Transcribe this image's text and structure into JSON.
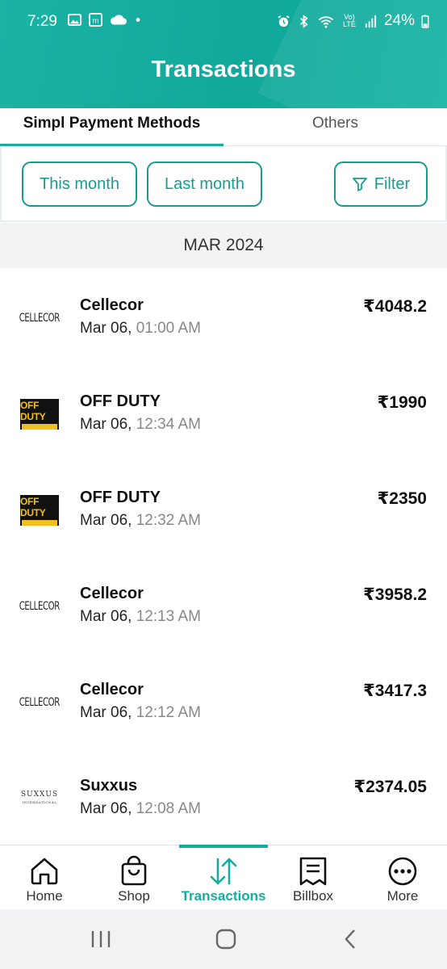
{
  "status_bar": {
    "time": "7:29",
    "battery": "24%",
    "network": "Vo) LTE"
  },
  "header": {
    "title": "Transactions"
  },
  "tabs": [
    {
      "label": "Simpl Payment Methods",
      "active": true
    },
    {
      "label": "Others",
      "active": false
    }
  ],
  "filters": {
    "this_month": "This month",
    "last_month": "Last month",
    "filter": "Filter"
  },
  "section": {
    "month": "MAR 2024"
  },
  "transactions": [
    {
      "merchant": "Cellecor",
      "logo": "cellecor-logo",
      "date": "Mar 06,",
      "time": " 01:00 AM",
      "amount": "₹4048.2"
    },
    {
      "merchant": "OFF DUTY",
      "logo": "offduty-logo",
      "date": "Mar 06,",
      "time": " 12:34 AM",
      "amount": "₹1990"
    },
    {
      "merchant": "OFF DUTY",
      "logo": "offduty-logo",
      "date": "Mar 06,",
      "time": " 12:32 AM",
      "amount": "₹2350"
    },
    {
      "merchant": "Cellecor",
      "logo": "cellecor-logo",
      "date": "Mar 06,",
      "time": " 12:13 AM",
      "amount": "₹3958.2"
    },
    {
      "merchant": "Cellecor",
      "logo": "cellecor-logo",
      "date": "Mar 06,",
      "time": " 12:12 AM",
      "amount": "₹3417.3"
    },
    {
      "merchant": "Suxxus",
      "logo": "suxxus-logo",
      "date": "Mar 06,",
      "time": " 12:08 AM",
      "amount": "₹2374.05"
    }
  ],
  "logos": {
    "cellecor": "CELLECOR",
    "offduty_line1": "OFF DUTY",
    "suxxus": "SUXXUS",
    "suxxus_sub": "INTERNATIONAL"
  },
  "bottom_nav": [
    {
      "label": "Home",
      "icon": "home-icon"
    },
    {
      "label": "Shop",
      "icon": "shopping-bag-icon"
    },
    {
      "label": "Transactions",
      "icon": "transactions-arrows-icon",
      "active": true
    },
    {
      "label": "Billbox",
      "icon": "receipt-icon"
    },
    {
      "label": "More",
      "icon": "more-dots-icon"
    }
  ],
  "colors": {
    "accent": "#14ad9e",
    "header": "#10a89a",
    "offduty_yellow": "#f2c01e"
  }
}
